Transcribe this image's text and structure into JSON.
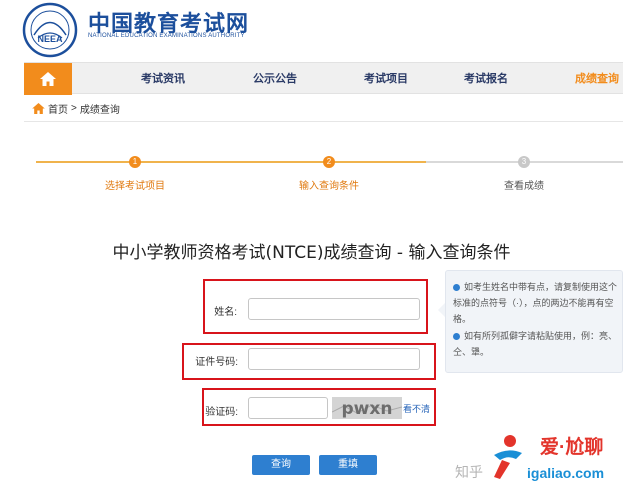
{
  "header": {
    "logo_cn": "中国教育考试网",
    "logo_en": "NATIONAL EDUCATION EXAMINATIONS AUTHORITY",
    "seal_text": "NEEA"
  },
  "nav": {
    "home_icon": "home-icon",
    "items": [
      {
        "label": "考试资讯"
      },
      {
        "label": "公示公告"
      },
      {
        "label": "考试项目"
      },
      {
        "label": "考试报名"
      },
      {
        "label": "成绩查询"
      }
    ],
    "active_color": "#f28c1c"
  },
  "breadcrumb": {
    "home": "首页",
    "sep": ">",
    "current": "成绩查询"
  },
  "steps": [
    {
      "num": "1",
      "label": "选择考试项目",
      "state": "done"
    },
    {
      "num": "2",
      "label": "输入查询条件",
      "state": "current"
    },
    {
      "num": "3",
      "label": "查看成绩",
      "state": "todo"
    }
  ],
  "title": "中小学教师资格考试(NTCE)成绩查询 - 输入查询条件",
  "form": {
    "name_label": "姓名:",
    "name_value": "",
    "id_label": "证件号码:",
    "id_value": "",
    "captcha_label": "验证码:",
    "captcha_value": "",
    "captcha_image_text": "pwxn",
    "captcha_refresh": "看不清"
  },
  "buttons": {
    "query": "查询",
    "reset": "重填"
  },
  "tips": [
    "如考生姓名中带有点，请复制使用这个标准的点符号（·），点的两边不能再有空格。",
    "如有所列孤僻字请粘贴使用，例：亮、仝、犟。"
  ],
  "watermark": {
    "zhihu": "知乎",
    "brand": "爱·尬聊",
    "url": "igaliao.com"
  },
  "colors": {
    "brand_blue": "#1c4f9c",
    "accent_orange": "#f28c1c",
    "highlight_red": "#d8141b",
    "button_blue": "#2e7fd0"
  }
}
